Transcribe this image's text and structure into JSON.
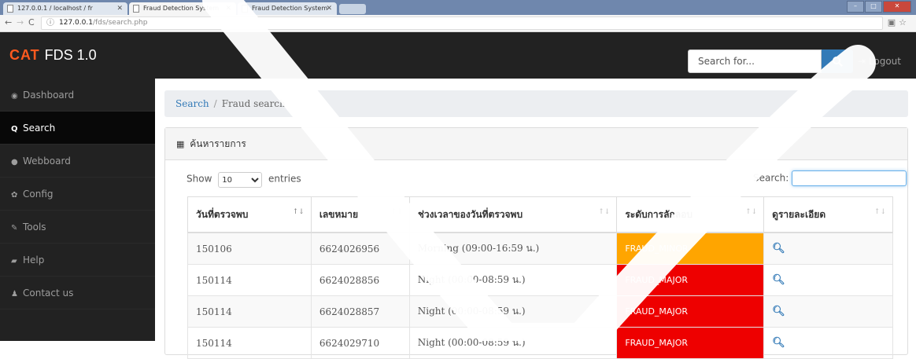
{
  "browser": {
    "tabs": [
      {
        "title": "127.0.0.1 / localhost / fr"
      },
      {
        "title": "Fraud Detection System"
      },
      {
        "title": "Fraud Detection System"
      }
    ],
    "url_host": "127.0.0.1",
    "url_path": "/fds/search.php"
  },
  "navbar": {
    "brand_logo": "CAT",
    "brand_name": "FDS 1.0",
    "search_placeholder": "Search for...",
    "logout_label": "Logout"
  },
  "sidebar": {
    "items": [
      {
        "label": "Dashboard",
        "icon": "dashboard-icon"
      },
      {
        "label": "Search",
        "icon": "search-icon"
      },
      {
        "label": "Webboard",
        "icon": "comment-icon"
      },
      {
        "label": "Config",
        "icon": "gear-icon"
      },
      {
        "label": "Tools",
        "icon": "wrench-icon"
      },
      {
        "label": "Help",
        "icon": "book-icon"
      },
      {
        "label": "Contact us",
        "icon": "user-icon"
      }
    ]
  },
  "breadcrumb": {
    "link": "Search",
    "current": "Fraud search"
  },
  "panel": {
    "title": "ค้นหารายการ"
  },
  "table_controls": {
    "show_label": "Show",
    "page_size": "10",
    "entries_label": "entries",
    "search_label": "Search:"
  },
  "table": {
    "columns": [
      "วันที่ตรวจพบ",
      "เลขหมาย",
      "ช่วงเวลาของวันที่ตรวจพบ",
      "ระดับการลักลอบ",
      "ดูรายละเอียด"
    ],
    "rows": [
      {
        "date": "150106",
        "number": "6624026956",
        "period": "Morning (09:00-16:59 น.)",
        "level": "FRAUD_MINOR"
      },
      {
        "date": "150114",
        "number": "6624028856",
        "period": "Night (00:00-08:59 น.)",
        "level": "FRAUD_MAJOR"
      },
      {
        "date": "150114",
        "number": "6624028857",
        "period": "Night (00:00-08:59 น.)",
        "level": "FRAUD_MAJOR"
      },
      {
        "date": "150114",
        "number": "6624029710",
        "period": "Night (00:00-08:59 น.)",
        "level": "FRAUD_MAJOR"
      }
    ]
  },
  "colors": {
    "navbar_bg": "#222222",
    "accent": "#337ab7",
    "fraud_minor": "#ffa500",
    "fraud_major": "#ee0000",
    "brand_logo": "#ff5a1f"
  }
}
